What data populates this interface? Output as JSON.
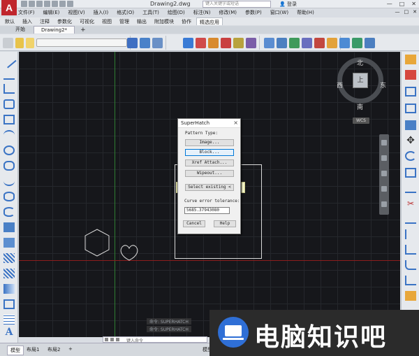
{
  "window": {
    "app_logo": "A",
    "doc_title": "Drawing2.dwg",
    "search_placeholder": "键入关键字或短语",
    "user_label": "登录",
    "controls": [
      "—",
      "□",
      "✕"
    ]
  },
  "menubar": {
    "items": [
      "文件(F)",
      "编辑(E)",
      "视图(V)",
      "插入(I)",
      "格式(O)",
      "工具(T)",
      "绘图(D)",
      "标注(N)",
      "修改(M)",
      "参数(P)",
      "窗口(W)",
      "帮助(H)"
    ],
    "right_controls": [
      "—",
      "□",
      "✕"
    ]
  },
  "ribbon_tabs": {
    "items": [
      "默认",
      "插入",
      "注释",
      "参数化",
      "可视化",
      "视图",
      "管理",
      "输出",
      "附加模块",
      "协作",
      "精选应用"
    ],
    "active_index": 10
  },
  "doc_tabs": {
    "items": [
      "开始",
      "Drawing2*"
    ],
    "add_label": "+",
    "active_index": 1
  },
  "viewcube": {
    "north": "北",
    "south": "南",
    "east": "东",
    "west": "西",
    "center": "上",
    "wcs": "WCS"
  },
  "dialog": {
    "title": "SuperHatch",
    "close": "×",
    "pattern_type_label": "Pattern Type:",
    "buttons": {
      "image": "Image...",
      "block": "Block...",
      "xref": "Xref Attach...",
      "wipeout": "Wipeout...",
      "select_existing": "Select existing <",
      "cancel": "Cancel",
      "help": "Help"
    },
    "tolerance_label": "Curve error tolerance:",
    "tolerance_value": "5685.37943080"
  },
  "command": {
    "history": [
      "命令: SUPERHATCH",
      "命令: SUPERHATCH"
    ],
    "prompt": "键入命令"
  },
  "statusbar": {
    "layout_tabs": [
      "模型",
      "布局1",
      "布局2"
    ],
    "active_index": 0,
    "model_label": "模型"
  },
  "watermark": {
    "text": "电脑知识吧"
  },
  "colors": {
    "canvas_bg": "#16171b",
    "x_axis": "#8c1d1d",
    "y_axis": "#2e7d32",
    "accent": "#0078d7",
    "watermark_blue": "#2f6fd6"
  }
}
